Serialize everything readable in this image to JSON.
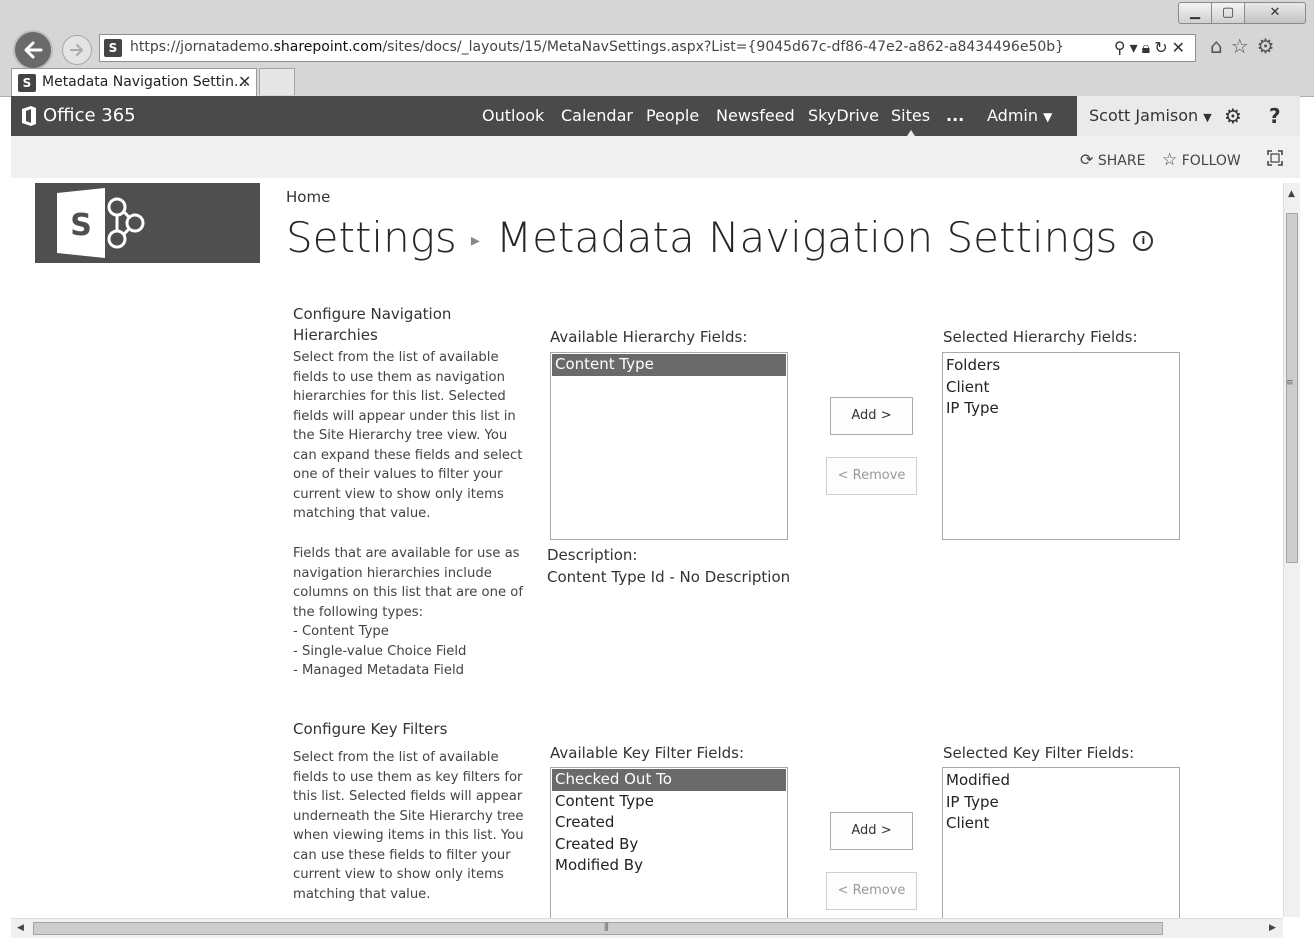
{
  "browser": {
    "url_prefix": "https://jornatademo.",
    "url_host": "sharepoint.com",
    "url_suffix": "/sites/docs/_layouts/15/MetaNavSettings.aspx?List={9045d67c-df86-47e2-a862-a8434496e50b}",
    "tab_title": "Metadata Navigation Settin...",
    "favicon_letter": "S"
  },
  "suite_bar": {
    "logo_text": "Office 365",
    "nav": [
      "Outlook",
      "Calendar",
      "People",
      "Newsfeed",
      "SkyDrive",
      "Sites",
      "...",
      "Admin"
    ],
    "user_name": "Scott Jamison",
    "help_label": "?"
  },
  "ribbon": {
    "share_label": "SHARE",
    "follow_label": "FOLLOW"
  },
  "page": {
    "breadcrumb": "Home",
    "title_parent": "Settings",
    "title_current": "Metadata Navigation Settings",
    "info_label": "i"
  },
  "hierarchies": {
    "heading": "Configure Navigation Hierarchies",
    "desc1": "Select from the list of available fields to use them as navigation hierarchies for this list.  Selected fields will appear under this list in the Site Hierarchy tree view.  You can expand these fields and select one of their values to filter your current view to show only items matching that value.",
    "desc2": "Fields that are available for use as navigation hierarchies include columns on this list that are one of the following types:",
    "types": [
      "- Content Type",
      "- Single-value Choice Field",
      "- Managed Metadata Field"
    ],
    "available_label": "Available Hierarchy Fields:",
    "available_items": [
      "Content Type"
    ],
    "selected_label": "Selected Hierarchy Fields:",
    "selected_items": [
      "Folders",
      "Client",
      "IP Type"
    ],
    "add_label": "Add >",
    "remove_label": "< Remove",
    "description_label": "Description:",
    "description_value": "Content Type Id - No Description"
  },
  "key_filters": {
    "heading": "Configure Key Filters",
    "desc": "Select from the list of available fields to use them as key filters for this list.  Selected fields will appear underneath the Site Hierarchy tree when viewing items in this list.  You can use these fields to filter your current view to show only items matching that value.",
    "available_label": "Available Key Filter Fields:",
    "available_items": [
      "Checked Out To",
      "Content Type",
      "Created",
      "Created By",
      "Modified By"
    ],
    "selected_label": "Selected Key Filter Fields:",
    "selected_items": [
      "Modified",
      "IP Type",
      "Client"
    ],
    "add_label": "Add >",
    "remove_label": "< Remove"
  }
}
